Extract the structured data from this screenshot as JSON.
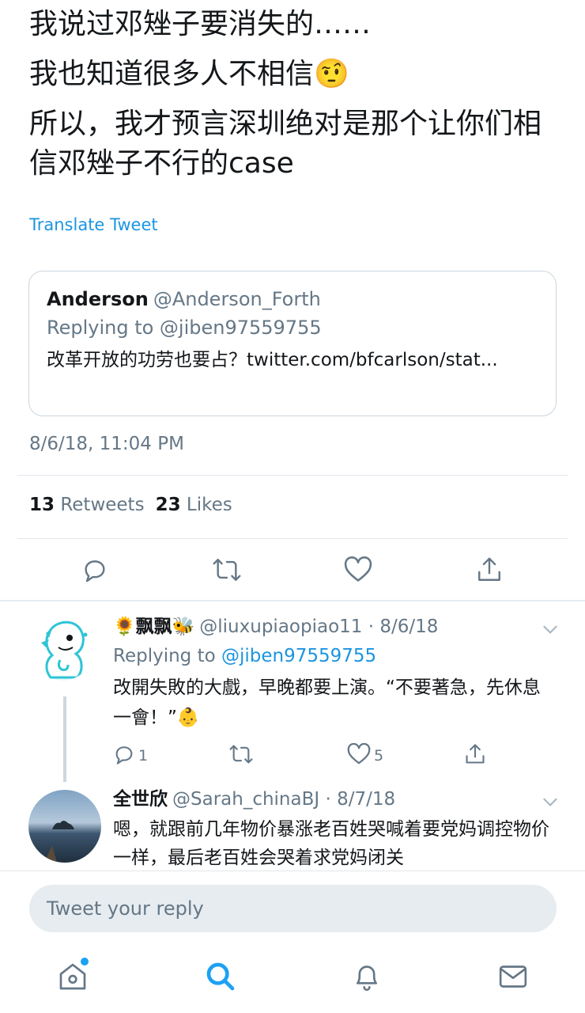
{
  "tweet": {
    "lines": [
      "我说过邓矬子要消失的……",
      "我也知道很多人不相信🤨",
      "所以，我才预言深圳绝对是那个让你们相信邓矬子不行的case"
    ],
    "translate_label": "Translate Tweet",
    "quote": {
      "name": "Anderson",
      "handle": "@Anderson_Forth",
      "replying_to": "Replying to @jiben97559755",
      "text": "改革开放的功劳也要占？twitter.com/bfcarlson/stat..."
    },
    "timestamp": "8/6/18, 11:04 PM",
    "stats": {
      "retweets_count": "13",
      "retweets_label": "Retweets",
      "likes_count": "23",
      "likes_label": "Likes"
    }
  },
  "replies": [
    {
      "name": "🌻飘飘🐝",
      "handle": "@liuxupiaopiao11 · 8/6/18",
      "replying_prefix": "Replying to ",
      "replying_mention": "@jiben97559755",
      "text": "改開失敗的大戲，早晚都要上演。“不要著急，先休息一會！”👶",
      "reply_count": "1",
      "retweet_count": "",
      "like_count": "5"
    },
    {
      "name": "全世欣",
      "handle": "@Sarah_chinaBJ · 8/7/18",
      "text": "嗯，就跟前几年物价暴涨老百姓哭喊着要党妈调控物价一样，最后老百姓会哭着求党妈闭关"
    }
  ],
  "reply_box": {
    "placeholder": "Tweet your reply"
  },
  "colors": {
    "accent": "#1da1f2",
    "link": "#1b95e0",
    "muted": "#657786",
    "text": "#14171a",
    "border": "#e1e8ed"
  },
  "icons": {
    "action_bar": [
      "reply-icon",
      "retweet-icon",
      "like-icon",
      "share-icon"
    ],
    "nav": [
      "home-icon",
      "search-icon",
      "notifications-icon",
      "messages-icon"
    ]
  }
}
